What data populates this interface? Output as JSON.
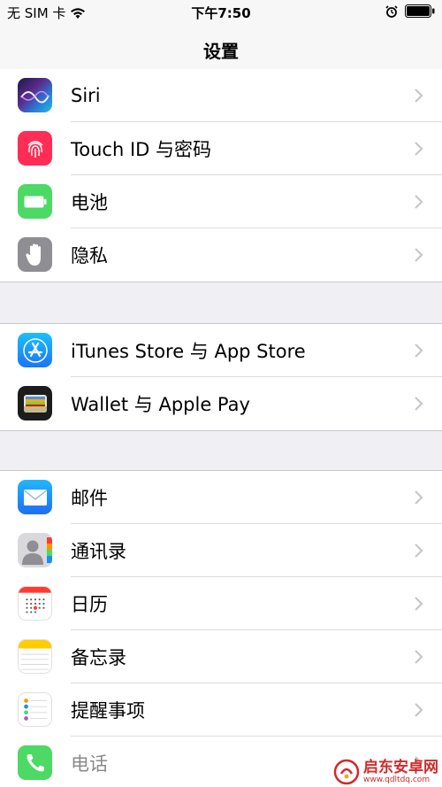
{
  "status_bar": {
    "carrier": "无 SIM 卡",
    "time": "下午7:50"
  },
  "nav": {
    "title": "设置"
  },
  "groups": [
    {
      "items": [
        {
          "label": "Siri",
          "icon": "siri-icon"
        },
        {
          "label": "Touch ID 与密码",
          "icon": "fingerprint-icon"
        },
        {
          "label": "电池",
          "icon": "battery-icon"
        },
        {
          "label": "隐私",
          "icon": "hand-icon"
        }
      ]
    },
    {
      "items": [
        {
          "label": "iTunes Store 与 App Store",
          "icon": "app-store-icon"
        },
        {
          "label": "Wallet 与 Apple Pay",
          "icon": "wallet-icon"
        }
      ]
    },
    {
      "items": [
        {
          "label": "邮件",
          "icon": "mail-icon"
        },
        {
          "label": "通讯录",
          "icon": "contacts-icon"
        },
        {
          "label": "日历",
          "icon": "calendar-icon"
        },
        {
          "label": "备忘录",
          "icon": "notes-icon"
        },
        {
          "label": "提醒事项",
          "icon": "reminders-icon"
        },
        {
          "label": "电话",
          "icon": "phone-icon"
        }
      ]
    }
  ],
  "watermark": {
    "name": "启东安卓网",
    "url": "www.qdltdq.com"
  },
  "colors": {
    "background": "#efeff4",
    "separator": "#c8c7cc",
    "chevron": "#c7c7cc",
    "privacy_gray": "#8e8e93",
    "battery_green": "#4cd964",
    "touchid_red": "#ff2d55",
    "appstore_blue": "#1d8ef5",
    "mail_blue": "#1f7ef6",
    "phone_green": "#4cd964"
  }
}
